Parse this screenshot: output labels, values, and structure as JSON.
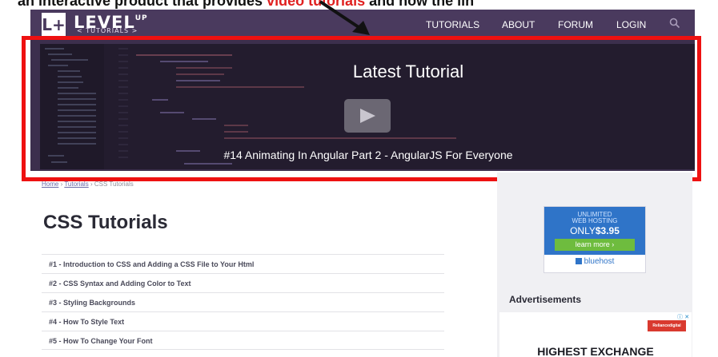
{
  "caption": {
    "text_before": "an interactive product that provides ",
    "text_highlight": "video tutorials",
    "text_after": " and how the lin"
  },
  "header": {
    "logo_mark": "L+",
    "logo_text": "LEVEL",
    "logo_superscript": "UP",
    "logo_subtitle": "< TUTORIALS >",
    "nav": [
      "TUTORIALS",
      "ABOUT",
      "FORUM",
      "LOGIN"
    ],
    "search_icon": "search-icon"
  },
  "hero": {
    "title": "Latest Tutorial",
    "play_icon": "play-icon",
    "video_title": "#14 Animating In Angular Part 2 - AngularJS For Everyone"
  },
  "breadcrumb": {
    "home": "Home",
    "separator": "›",
    "tutorials": "Tutorials",
    "current": "CSS Tutorials"
  },
  "main": {
    "title": "CSS Tutorials",
    "tutorials": [
      "#1 - Introduction to CSS and Adding a CSS File to Your Html",
      "#2 - CSS Syntax and Adding Color to Text",
      "#3 - Styling Backgrounds",
      "#4 - How To Style Text",
      "#5 - How To Change Your Font"
    ]
  },
  "sidebar": {
    "hosting_ad": {
      "line1": "UNLIMITED",
      "line2": "WEB HOSTING",
      "price_prefix": "ONLY",
      "price": "$3.95",
      "cta": "learn more ›",
      "brand": "bluehost"
    },
    "ads_heading": "Advertisements",
    "banner": {
      "logo": "Reliancedigital",
      "marks": "ⓘ ✕",
      "text": "HIGHEST EXCHANGE"
    }
  },
  "colors": {
    "header_bg": "#4a3a5e",
    "hero_bg": "#241c2f",
    "highlight": "#ee1111",
    "hosting_blue": "#2f74c8",
    "hosting_green": "#6ebc3e"
  }
}
